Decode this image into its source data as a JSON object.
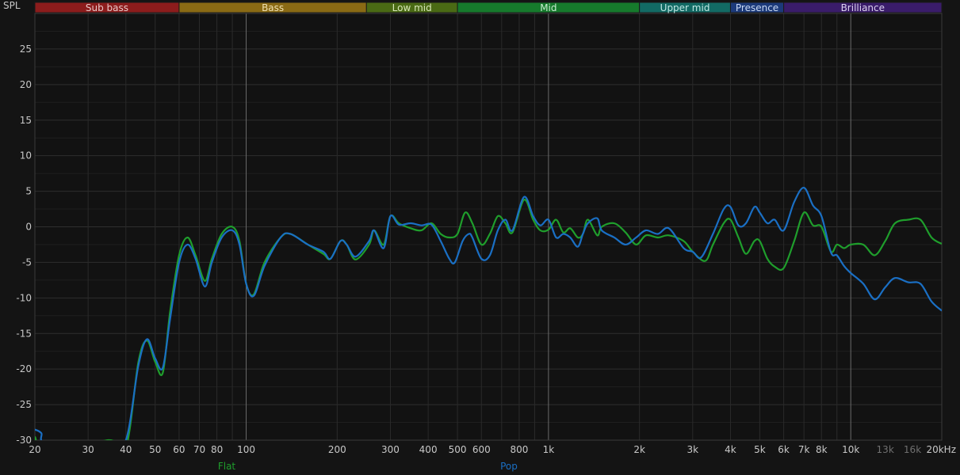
{
  "chart_data": {
    "type": "line",
    "ylabel": "SPL",
    "x_scale": "log",
    "xlim": [
      20,
      20000
    ],
    "ylim": [
      -30,
      30
    ],
    "grid": true,
    "legend_position": "bottom",
    "y_ticks": [
      -30,
      -25,
      -20,
      -15,
      -10,
      -5,
      0,
      5,
      10,
      15,
      20,
      25
    ],
    "x_ticks": [
      {
        "value": 20,
        "label": "20"
      },
      {
        "value": 30,
        "label": "30"
      },
      {
        "value": 40,
        "label": "40"
      },
      {
        "value": 50,
        "label": "50"
      },
      {
        "value": 60,
        "label": "60"
      },
      {
        "value": 70,
        "label": "70"
      },
      {
        "value": 80,
        "label": "80"
      },
      {
        "value": 100,
        "label": "100"
      },
      {
        "value": 200,
        "label": "200"
      },
      {
        "value": 300,
        "label": "300"
      },
      {
        "value": 400,
        "label": "400"
      },
      {
        "value": 500,
        "label": "500"
      },
      {
        "value": 600,
        "label": "600"
      },
      {
        "value": 800,
        "label": "800"
      },
      {
        "value": 1000,
        "label": "1k"
      },
      {
        "value": 2000,
        "label": "2k"
      },
      {
        "value": 3000,
        "label": "3k"
      },
      {
        "value": 4000,
        "label": "4k"
      },
      {
        "value": 5000,
        "label": "5k"
      },
      {
        "value": 6000,
        "label": "6k"
      },
      {
        "value": 7000,
        "label": "7k"
      },
      {
        "value": 8000,
        "label": "8k"
      },
      {
        "value": 10000,
        "label": "10k"
      },
      {
        "value": 13000,
        "label": "13k",
        "dim": true
      },
      {
        "value": 16000,
        "label": "16k",
        "dim": true
      },
      {
        "value": 20000,
        "label": "20kHz"
      }
    ],
    "bands": [
      {
        "name": "Sub bass",
        "from": 20,
        "to": 60,
        "color": "#8c1c1c",
        "text_color": "#e8c8c8"
      },
      {
        "name": "Bass",
        "from": 60,
        "to": 250,
        "color": "#8a6a14",
        "text_color": "#efe0b0"
      },
      {
        "name": "Low mid",
        "from": 250,
        "to": 500,
        "color": "#4a6a14",
        "text_color": "#d8e8b8"
      },
      {
        "name": "Mid",
        "from": 500,
        "to": 2000,
        "color": "#167a2c",
        "text_color": "#c8ecd0"
      },
      {
        "name": "Upper mid",
        "from": 2000,
        "to": 4000,
        "color": "#126a64",
        "text_color": "#c0e8e4"
      },
      {
        "name": "Presence",
        "from": 4000,
        "to": 6000,
        "color": "#1c3a7a",
        "text_color": "#c8d8f4"
      },
      {
        "name": "Brilliance",
        "from": 6000,
        "to": 20000,
        "color": "#3a1c6a",
        "text_color": "#dcd0f0"
      }
    ],
    "series": [
      {
        "name": "Flat",
        "color": "#1f9e2c",
        "points": [
          [
            20,
            -29.5
          ],
          [
            22,
            -32
          ],
          [
            35,
            -30
          ],
          [
            40,
            -31
          ],
          [
            44,
            -19
          ],
          [
            47,
            -16
          ],
          [
            50,
            -19
          ],
          [
            53,
            -20.5
          ],
          [
            56,
            -12
          ],
          [
            60,
            -4
          ],
          [
            64,
            -1.5
          ],
          [
            68,
            -4
          ],
          [
            73,
            -7.6
          ],
          [
            77,
            -4.5
          ],
          [
            83,
            -1
          ],
          [
            90,
            0
          ],
          [
            95,
            -2
          ],
          [
            100,
            -8
          ],
          [
            106,
            -9.5
          ],
          [
            115,
            -5
          ],
          [
            130,
            -1.5
          ],
          [
            140,
            -1
          ],
          [
            160,
            -2.5
          ],
          [
            180,
            -3.8
          ],
          [
            190,
            -4.5
          ],
          [
            205,
            -2
          ],
          [
            215,
            -2.5
          ],
          [
            230,
            -4.6
          ],
          [
            255,
            -2.5
          ],
          [
            265,
            -0.5
          ],
          [
            285,
            -2.5
          ],
          [
            300,
            1.5
          ],
          [
            320,
            0.5
          ],
          [
            350,
            -0.2
          ],
          [
            380,
            -0.5
          ],
          [
            410,
            0.5
          ],
          [
            440,
            -1
          ],
          [
            470,
            -1.5
          ],
          [
            500,
            -1
          ],
          [
            530,
            2
          ],
          [
            560,
            0.5
          ],
          [
            600,
            -2.5
          ],
          [
            640,
            -1
          ],
          [
            680,
            1.5
          ],
          [
            720,
            0.5
          ],
          [
            760,
            -0.8
          ],
          [
            830,
            3.8
          ],
          [
            890,
            1
          ],
          [
            940,
            -0.5
          ],
          [
            1000,
            -0.4
          ],
          [
            1060,
            1
          ],
          [
            1120,
            -0.8
          ],
          [
            1180,
            -0.2
          ],
          [
            1250,
            -1.5
          ],
          [
            1300,
            -1
          ],
          [
            1350,
            1
          ],
          [
            1450,
            -1.2
          ],
          [
            1500,
            0
          ],
          [
            1650,
            0.5
          ],
          [
            1800,
            -0.8
          ],
          [
            1950,
            -2.5
          ],
          [
            2100,
            -1.2
          ],
          [
            2300,
            -1.5
          ],
          [
            2500,
            -1.2
          ],
          [
            2800,
            -2
          ],
          [
            3000,
            -3.5
          ],
          [
            3300,
            -4.8
          ],
          [
            3500,
            -2.5
          ],
          [
            3800,
            0.5
          ],
          [
            4000,
            1
          ],
          [
            4250,
            -1.5
          ],
          [
            4500,
            -3.8
          ],
          [
            4800,
            -2
          ],
          [
            5000,
            -2
          ],
          [
            5300,
            -4.5
          ],
          [
            5600,
            -5.6
          ],
          [
            6000,
            -5.8
          ],
          [
            6500,
            -2
          ],
          [
            7000,
            2
          ],
          [
            7500,
            0.2
          ],
          [
            8000,
            0
          ],
          [
            8600,
            -3.5
          ],
          [
            9000,
            -2.5
          ],
          [
            9500,
            -3
          ],
          [
            10000,
            -2.5
          ],
          [
            11000,
            -2.5
          ],
          [
            12000,
            -4
          ],
          [
            13000,
            -2
          ],
          [
            14000,
            0.5
          ],
          [
            15500,
            1
          ],
          [
            17000,
            1
          ],
          [
            18500,
            -1.5
          ],
          [
            20000,
            -2.4
          ]
        ]
      },
      {
        "name": "Pop",
        "color": "#1a6fc4",
        "points": [
          [
            20,
            -28.5
          ],
          [
            21,
            -29
          ],
          [
            22,
            -30.5
          ],
          [
            35,
            -31
          ],
          [
            40,
            -30
          ],
          [
            44,
            -19.5
          ],
          [
            47,
            -15.8
          ],
          [
            50,
            -18.5
          ],
          [
            53,
            -19.8
          ],
          [
            56,
            -13
          ],
          [
            60,
            -5
          ],
          [
            64,
            -2.5
          ],
          [
            68,
            -4.5
          ],
          [
            73,
            -8.4
          ],
          [
            77,
            -5
          ],
          [
            83,
            -1.5
          ],
          [
            90,
            -0.5
          ],
          [
            95,
            -2.5
          ],
          [
            100,
            -8
          ],
          [
            106,
            -9.7
          ],
          [
            115,
            -5.5
          ],
          [
            130,
            -1.5
          ],
          [
            140,
            -1
          ],
          [
            160,
            -2.5
          ],
          [
            180,
            -3.5
          ],
          [
            190,
            -4.5
          ],
          [
            205,
            -2
          ],
          [
            215,
            -2.5
          ],
          [
            230,
            -4.2
          ],
          [
            255,
            -2
          ],
          [
            265,
            -0.5
          ],
          [
            285,
            -3
          ],
          [
            300,
            1.5
          ],
          [
            320,
            0.3
          ],
          [
            350,
            0.5
          ],
          [
            380,
            0.2
          ],
          [
            410,
            0.3
          ],
          [
            440,
            -2
          ],
          [
            470,
            -4.5
          ],
          [
            490,
            -5
          ],
          [
            520,
            -2
          ],
          [
            545,
            -1
          ],
          [
            560,
            -1.5
          ],
          [
            600,
            -4.5
          ],
          [
            640,
            -4
          ],
          [
            680,
            -0.5
          ],
          [
            720,
            1
          ],
          [
            760,
            -0.5
          ],
          [
            830,
            4.2
          ],
          [
            890,
            1.5
          ],
          [
            940,
            0.2
          ],
          [
            1000,
            1
          ],
          [
            1060,
            -1.5
          ],
          [
            1120,
            -1
          ],
          [
            1180,
            -1.5
          ],
          [
            1250,
            -2.8
          ],
          [
            1300,
            -1
          ],
          [
            1350,
            0.5
          ],
          [
            1450,
            1.2
          ],
          [
            1500,
            -0.5
          ],
          [
            1650,
            -1.5
          ],
          [
            1800,
            -2.5
          ],
          [
            1950,
            -1.5
          ],
          [
            2100,
            -0.5
          ],
          [
            2300,
            -1
          ],
          [
            2500,
            -0.2
          ],
          [
            2800,
            -3
          ],
          [
            3000,
            -3.5
          ],
          [
            3200,
            -4.3
          ],
          [
            3500,
            -1
          ],
          [
            3800,
            2.5
          ],
          [
            4000,
            2.8
          ],
          [
            4250,
            0.2
          ],
          [
            4500,
            0.5
          ],
          [
            4800,
            2.8
          ],
          [
            5000,
            2
          ],
          [
            5300,
            0.5
          ],
          [
            5600,
            1
          ],
          [
            6000,
            -0.5
          ],
          [
            6500,
            3.5
          ],
          [
            7000,
            5.5
          ],
          [
            7500,
            3
          ],
          [
            8000,
            1.5
          ],
          [
            8600,
            -3.6
          ],
          [
            9000,
            -4
          ],
          [
            9500,
            -5.5
          ],
          [
            10000,
            -6.5
          ],
          [
            11000,
            -8
          ],
          [
            12000,
            -10.2
          ],
          [
            13000,
            -8.5
          ],
          [
            14000,
            -7.2
          ],
          [
            15500,
            -7.8
          ],
          [
            17000,
            -8
          ],
          [
            18500,
            -10.5
          ],
          [
            20000,
            -11.8
          ]
        ]
      }
    ]
  }
}
